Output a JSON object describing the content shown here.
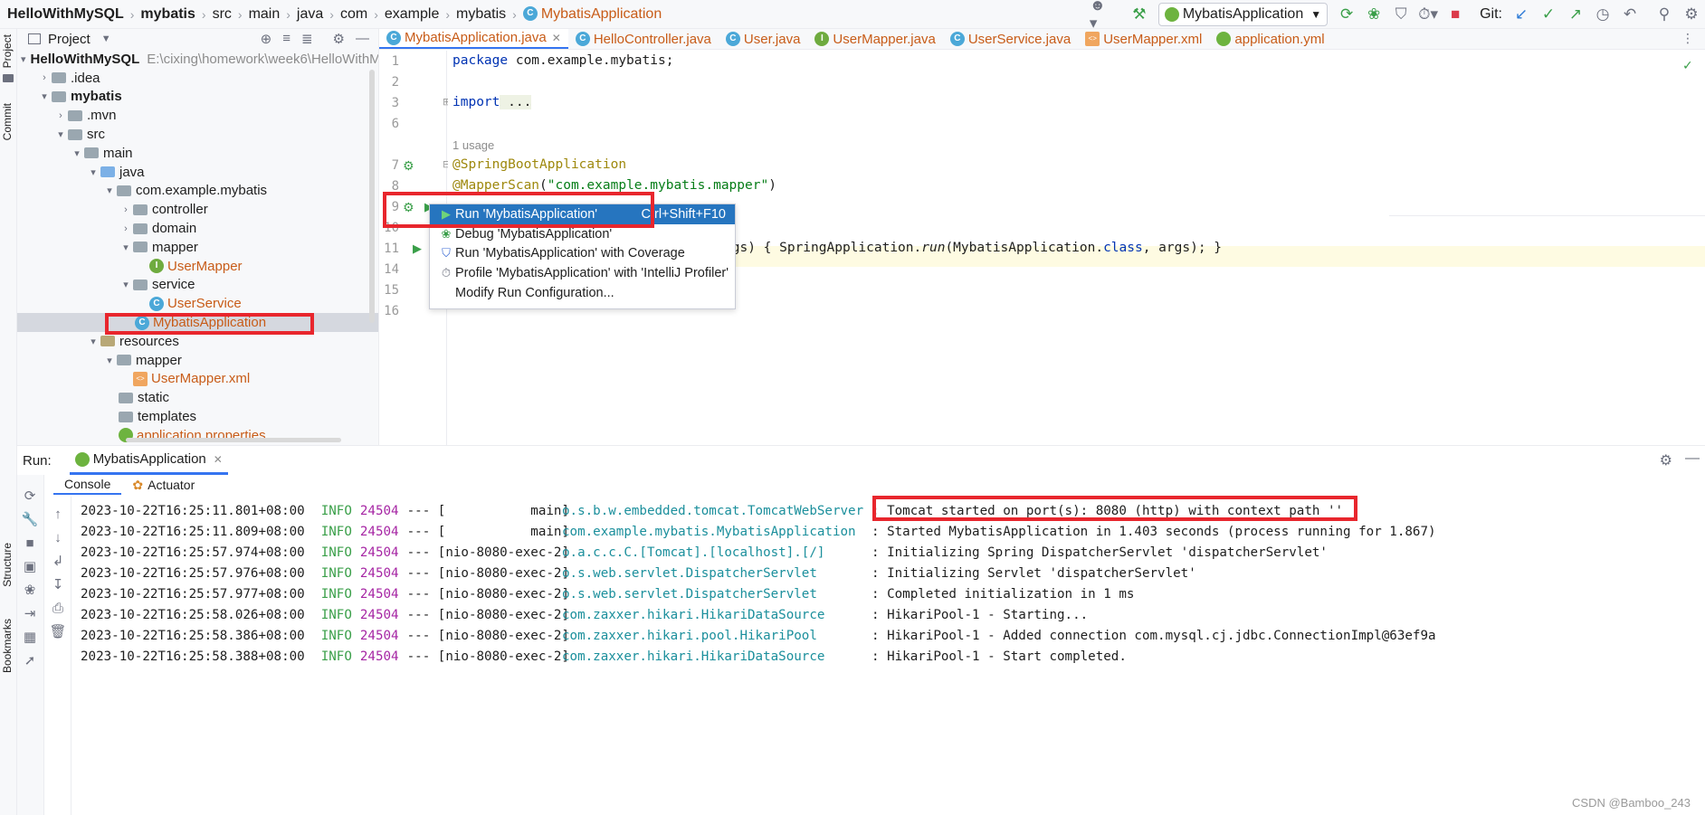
{
  "breadcrumbs": [
    "HelloWithMySQL",
    "mybatis",
    "src",
    "main",
    "java",
    "com",
    "example",
    "mybatis",
    "MybatisApplication"
  ],
  "toolbar": {
    "run_config": "MybatisApplication",
    "git_label": "Git:"
  },
  "left_stripe": {
    "project": "Project",
    "commit": "Commit",
    "structure": "Structure",
    "bookmarks": "Bookmarks"
  },
  "project_panel": {
    "title": "Project",
    "tree": [
      {
        "label": "HelloWithMySQL",
        "path": "E:\\cixing\\homework\\week6\\HelloWithM"
      },
      {
        "label": ".idea"
      },
      {
        "label": "mybatis"
      },
      {
        "label": ".mvn"
      },
      {
        "label": "src"
      },
      {
        "label": "main"
      },
      {
        "label": "java"
      },
      {
        "label": "com.example.mybatis"
      },
      {
        "label": "controller"
      },
      {
        "label": "domain"
      },
      {
        "label": "mapper"
      },
      {
        "label": "UserMapper"
      },
      {
        "label": "service"
      },
      {
        "label": "UserService"
      },
      {
        "label": "MybatisApplication"
      },
      {
        "label": "resources"
      },
      {
        "label": "mapper"
      },
      {
        "label": "UserMapper.xml"
      },
      {
        "label": "static"
      },
      {
        "label": "templates"
      },
      {
        "label": "application.properties"
      }
    ]
  },
  "editor_tabs": [
    {
      "label": "MybatisApplication.java"
    },
    {
      "label": "HelloController.java"
    },
    {
      "label": "User.java"
    },
    {
      "label": "UserMapper.java"
    },
    {
      "label": "UserService.java"
    },
    {
      "label": "UserMapper.xml"
    },
    {
      "label": "application.yml"
    }
  ],
  "code": {
    "line_numbers": [
      "1",
      "2",
      "3",
      "6",
      "7",
      "8",
      "9",
      "10",
      "11",
      "14",
      "15",
      "16"
    ],
    "l1_kw": "package",
    "l1_rest": " com.example.mybatis;",
    "l3_kw": "import",
    "l3_rest": " ...",
    "usage_hint": "1 usage",
    "l7": "@SpringBootApplication",
    "l8_ann": "@MapperScan",
    "l8_open": "(",
    "l8_str": "\"com.example.mybatis.mapper\"",
    "l8_close": ")",
    "l11_a": "rgs) { SpringApplication.",
    "l11_run": "run",
    "l11_b": "(MybatisApplication.",
    "l11_class": "class",
    "l11_c": ", args); }"
  },
  "context_menu": {
    "items": [
      {
        "label": "Run 'MybatisApplication'",
        "shortcut": "Ctrl+Shift+F10"
      },
      {
        "label": "Debug 'MybatisApplication'"
      },
      {
        "label": "Run 'MybatisApplication' with Coverage"
      },
      {
        "label": "Profile 'MybatisApplication' with 'IntelliJ Profiler'"
      },
      {
        "label": "Modify Run Configuration..."
      }
    ]
  },
  "run_panel": {
    "title": "Run:",
    "tab": "MybatisApplication",
    "subtabs": [
      "Console",
      "Actuator"
    ],
    "logs": [
      {
        "ts": "2023-10-22T16:25:11.801+08:00",
        "level": "INFO",
        "pid": "24504",
        "thread": "--- [           main]",
        "logger": "o.s.b.w.embedded.tomcat.TomcatWebServer",
        "msg": ": Tomcat started on port(s): 8080 (http) with context path ''"
      },
      {
        "ts": "2023-10-22T16:25:11.809+08:00",
        "level": "INFO",
        "pid": "24504",
        "thread": "--- [           main]",
        "logger": "com.example.mybatis.MybatisApplication",
        "msg": ": Started MybatisApplication in 1.403 seconds (process running for 1.867)"
      },
      {
        "ts": "2023-10-22T16:25:57.974+08:00",
        "level": "INFO",
        "pid": "24504",
        "thread": "--- [nio-8080-exec-2]",
        "logger": "o.a.c.c.C.[Tomcat].[localhost].[/]",
        "msg": ": Initializing Spring DispatcherServlet 'dispatcherServlet'"
      },
      {
        "ts": "2023-10-22T16:25:57.976+08:00",
        "level": "INFO",
        "pid": "24504",
        "thread": "--- [nio-8080-exec-2]",
        "logger": "o.s.web.servlet.DispatcherServlet",
        "msg": ": Initializing Servlet 'dispatcherServlet'"
      },
      {
        "ts": "2023-10-22T16:25:57.977+08:00",
        "level": "INFO",
        "pid": "24504",
        "thread": "--- [nio-8080-exec-2]",
        "logger": "o.s.web.servlet.DispatcherServlet",
        "msg": ": Completed initialization in 1 ms"
      },
      {
        "ts": "2023-10-22T16:25:58.026+08:00",
        "level": "INFO",
        "pid": "24504",
        "thread": "--- [nio-8080-exec-2]",
        "logger": "com.zaxxer.hikari.HikariDataSource",
        "msg": ": HikariPool-1 - Starting..."
      },
      {
        "ts": "2023-10-22T16:25:58.386+08:00",
        "level": "INFO",
        "pid": "24504",
        "thread": "--- [nio-8080-exec-2]",
        "logger": "com.zaxxer.hikari.pool.HikariPool",
        "msg": ": HikariPool-1 - Added connection com.mysql.cj.jdbc.ConnectionImpl@63ef9a"
      },
      {
        "ts": "2023-10-22T16:25:58.388+08:00",
        "level": "INFO",
        "pid": "24504",
        "thread": "--- [nio-8080-exec-2]",
        "logger": "com.zaxxer.hikari.HikariDataSource",
        "msg": ": HikariPool-1 - Start completed."
      }
    ]
  },
  "watermark": "CSDN @Bamboo_243",
  "colors": {
    "accent": "#3574f0",
    "annotation_red": "#e8262d",
    "menu_selected": "#2675bf"
  }
}
